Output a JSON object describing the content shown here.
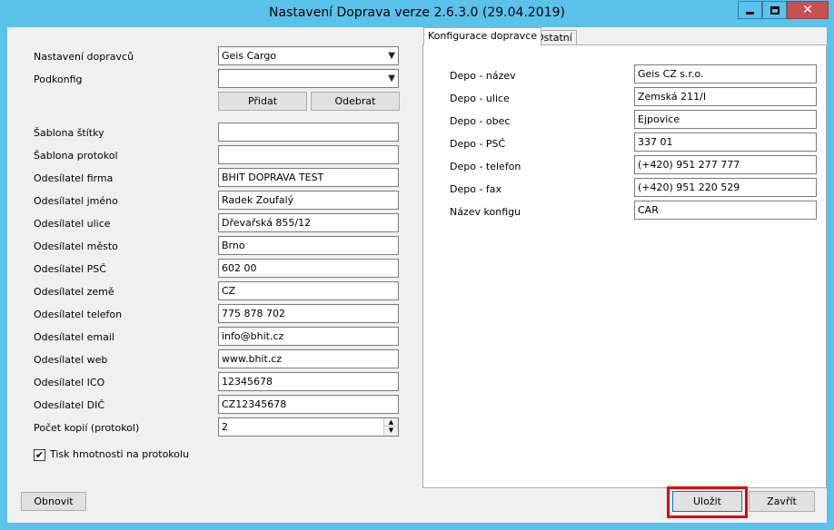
{
  "window": {
    "title": "Nastavení Doprava verze 2.6.3.0 (29.04.2019)",
    "controls": {
      "minimize": "minimize-icon",
      "maximize": "maximize-icon",
      "close": "close-icon",
      "close_glyph": "✕"
    }
  },
  "left": {
    "carrier_label": "Nastavení dopravců",
    "carrier_value": "Geis Cargo",
    "subconfig_label": "Podkonfig",
    "subconfig_value": "",
    "add_button": "Přidat",
    "remove_button": "Odebrat",
    "fields": [
      {
        "label": "Šablona štítky",
        "value": ""
      },
      {
        "label": "Šablona protokol",
        "value": ""
      },
      {
        "label": "Odesílatel firma",
        "value": "BHIT DOPRAVA TEST"
      },
      {
        "label": "Odesílatel jméno",
        "value": "Radek Zoufalý"
      },
      {
        "label": "Odesílatel ulice",
        "value": "Dřevařská 855/12"
      },
      {
        "label": "Odesílatel město",
        "value": "Brno"
      },
      {
        "label": "Odesílatel PSČ",
        "value": "602 00"
      },
      {
        "label": "Odesílatel země",
        "value": "CZ"
      },
      {
        "label": "Odesílatel telefon",
        "value": "775 878 702"
      },
      {
        "label": "Odesílatel email",
        "value": "info@bhit.cz"
      },
      {
        "label": "Odesílatel web",
        "value": "www.bhit.cz"
      },
      {
        "label": "Odesílatel ICO",
        "value": "12345678"
      },
      {
        "label": "Odesílatel DIČ",
        "value": "CZ12345678"
      }
    ],
    "copies_label": "Počet kopií (protokol)",
    "copies_value": "2",
    "print_weight_label": "Tisk hmotnosti na protokolu",
    "print_weight_checked": true,
    "checkmark": "✔"
  },
  "tabs": [
    {
      "label": "Konfigurace dopravce",
      "active": true
    },
    {
      "label": "Ostatní",
      "active": false
    }
  ],
  "carrier_config": [
    {
      "label": "Depo - název",
      "value": "Geis CZ s.r.o."
    },
    {
      "label": "Depo - ulice",
      "value": "Zemská 211/I"
    },
    {
      "label": "Depo - obec",
      "value": "Ejpovice"
    },
    {
      "label": "Depo - PSČ",
      "value": "337 01"
    },
    {
      "label": "Depo - telefon",
      "value": "(+420) 951 277 777"
    },
    {
      "label": "Depo - fax",
      "value": "(+420) 951 220 529"
    },
    {
      "label": "Název konfigu",
      "value": "CAR"
    }
  ],
  "footer": {
    "refresh_button": "Obnovit",
    "save_button": "Uložit",
    "close_button": "Zavřít"
  },
  "colors": {
    "title_bar": "#5bc3eb",
    "close_button": "#c75050",
    "highlight": "#e00000"
  }
}
